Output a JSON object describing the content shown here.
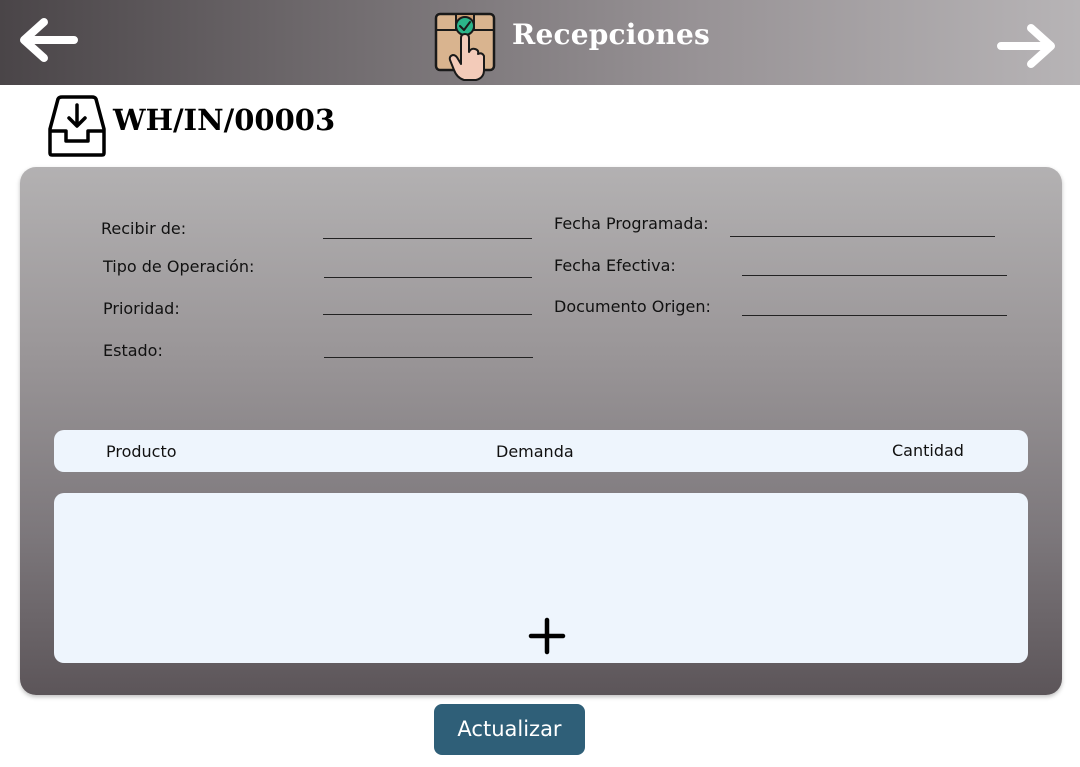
{
  "header": {
    "title": "Recepciones",
    "back_icon": "arrow-left-icon",
    "forward_icon": "arrow-right-icon",
    "app_icon": "box-touch-icon"
  },
  "document": {
    "icon": "inbox-download-icon",
    "reference": "WH/IN/00003"
  },
  "form": {
    "left": [
      {
        "label": "Recibir de:",
        "value": ""
      },
      {
        "label": "Tipo de Operación:",
        "value": ""
      },
      {
        "label": "Prioridad:",
        "value": ""
      },
      {
        "label": "Estado:",
        "value": ""
      }
    ],
    "right": [
      {
        "label": "Fecha Programada:",
        "value": ""
      },
      {
        "label": "Fecha Efectiva:",
        "value": ""
      },
      {
        "label": "Documento Origen:",
        "value": ""
      }
    ]
  },
  "table": {
    "columns": [
      "Producto",
      "Demanda",
      "Cantidad"
    ],
    "rows": [],
    "add_icon": "plus-icon"
  },
  "actions": {
    "update_label": "Actualizar"
  },
  "colors": {
    "button": "#2f5f78",
    "table_bg": "#eef5fd",
    "header_dark": "#4a4548",
    "header_light": "#b7b4b6",
    "icon_check": "#2bb58a",
    "icon_box": "#d9b48f"
  }
}
